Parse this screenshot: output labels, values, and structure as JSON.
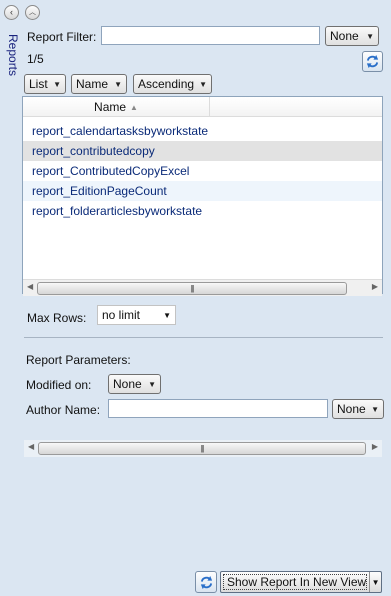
{
  "nav": {
    "back_glyph": "‹",
    "up_glyph": "︿"
  },
  "side_tab": {
    "label": "Reports"
  },
  "filter": {
    "label": "Report Filter:",
    "value": "",
    "mode": "None"
  },
  "count": "1/5",
  "view_controls": {
    "view": "List",
    "sort_field": "Name",
    "sort_order": "Ascending"
  },
  "table": {
    "column_header": "Name",
    "sort_glyph": "▲",
    "rows": [
      "report_calendartasksbyworkstate",
      "report_contributedcopy",
      "report_ContributedCopyExcel",
      "report_EditionPageCount",
      "report_folderarticlesbyworkstate"
    ],
    "selected_index": 1
  },
  "scroll_grip": "|||",
  "max_rows": {
    "label": "Max Rows:",
    "value": "no limit"
  },
  "parameters": {
    "section_label": "Report Parameters:",
    "modified_label": "Modified on:",
    "modified_value": "None",
    "author_label": "Author Name:",
    "author_value": "",
    "author_mode": "None"
  },
  "footer": {
    "show_button_label": "Show Report In New View"
  },
  "colors": {
    "link_text": "#0a2a78",
    "panel_bg": "#dbe6f2",
    "tab_text": "#1a237e"
  }
}
